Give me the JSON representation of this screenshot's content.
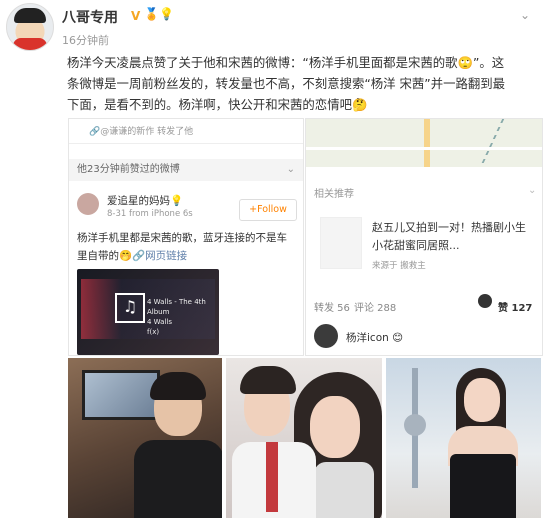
{
  "post": {
    "username": "八哥专用",
    "vbadge": "V",
    "level_badges": "🏅💡",
    "time": "16分钟前",
    "chevron": "⌄",
    "text_line1": "杨洋今天凌晨点赞了关于他和宋茜的微博：“杨洋手机里面都是宋茜的歌🙄”。这",
    "text_line2": "条微博是一周前粉丝发的，转发量也不高，不刻意搜索“杨洋 宋茜”并一路翻到最",
    "text_line3": "下面，是看不到的。杨洋啊，快公开和宋茜的恋情吧🤔"
  },
  "left_shot": {
    "top_link": "🔗@谦谦的新作 转发了他",
    "liked_label": "他23分钟前赞过的微博",
    "liked_chevron": "⌄",
    "author_name": "爱追星的妈妈💡",
    "author_meta": "8-31 from iPhone 6s",
    "follow_label": "+Follow",
    "text": "杨洋手机里都是宋茜的歌，蓝牙连接的不是车里自带的🤭",
    "link_label": "🔗网页链接",
    "album_glyph": "♫",
    "song_line1": "4 Walls - The 4th Album",
    "song_line2": "4 Walls",
    "song_line3": "f(x)"
  },
  "right_shot": {
    "rec_title": "相关推荐",
    "rec_chevron": "⌄",
    "rec_text": "赵五儿又拍到一对！热播剧小生小花甜蜜同居照...",
    "rec_source": "来源于 搬救主",
    "repost_label": "转发 56",
    "comment_label": "评论 288",
    "like_label": "赞 127",
    "liker_name": "杨洋icon 😊"
  }
}
